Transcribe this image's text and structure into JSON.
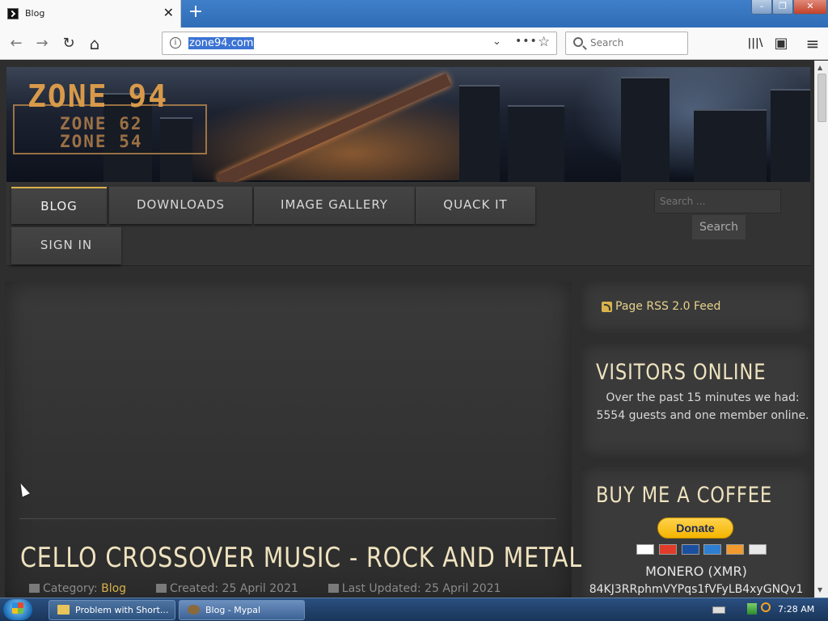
{
  "browser": {
    "tab_title": "Blog",
    "tab_close": "✕",
    "new_tab": "+",
    "url": "zone94.com",
    "search_placeholder": "Search",
    "window_controls": {
      "minimize": "–",
      "maximize": "❐",
      "close": "✕"
    },
    "nav_icons": {
      "back": "←",
      "forward": "→",
      "reload": "↻",
      "home": "⌂",
      "library": "|||\\",
      "sidebar": "▣",
      "menu": "≡"
    },
    "url_icons": {
      "info": "i",
      "dropdown": "⌄",
      "more": "•••",
      "bookmark": "☆"
    }
  },
  "site": {
    "logo": {
      "main": "ZONE 94",
      "sub1": "ZONE 62",
      "sub2": "ZONE 54"
    },
    "menu": [
      "BLOG",
      "DOWNLOADS",
      "IMAGE GALLERY",
      "QUACK IT",
      "SIGN IN"
    ],
    "search_placeholder": "Search ...",
    "search_button": "Search",
    "article": {
      "title": "CELLO CROSSOVER MUSIC - ROCK AND METAL",
      "category_label": "Category:",
      "category_value": "Blog",
      "created": "Created: 25 April 2021",
      "updated": "Last Updated: 25 April 2021"
    },
    "sidebar": {
      "rss_link": "Page RSS 2.0 Feed",
      "visitors_heading": "VISITORS ONLINE",
      "visitors_text": "Over the past 15 minutes we had: 5554 guests and one member online.",
      "coffee_heading": "BUY ME A COFFEE",
      "donate_button": "Donate",
      "monero_label": "MONERO (XMR)",
      "monero_address": "84KJ3RRphmVYPqs1fVFyLB4xyGNQv1"
    }
  },
  "taskbar": {
    "tasks": [
      "Problem with Short...",
      "Blog - Mypal"
    ],
    "time": "7:28 AM"
  },
  "colors": {
    "accent_gold": "#d9b24a",
    "heading_cream": "#efe3bf",
    "taskbar_blue": "#2a4f80"
  }
}
